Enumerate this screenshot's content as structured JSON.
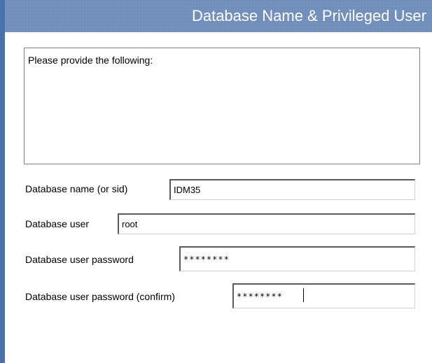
{
  "header": {
    "title": "Database Name & Privileged User"
  },
  "description": {
    "text": "Please provide the following:"
  },
  "form": {
    "db_name": {
      "label": "Database name (or sid)",
      "value": "IDM35"
    },
    "db_user": {
      "label": "Database user",
      "value": "root"
    },
    "db_password": {
      "label": "Database user password",
      "value": "********"
    },
    "db_password_confirm": {
      "label": "Database user password (confirm)",
      "value": "********"
    }
  },
  "colors": {
    "header_background": "#6f8fbd",
    "left_accent": "#4a72aa"
  }
}
